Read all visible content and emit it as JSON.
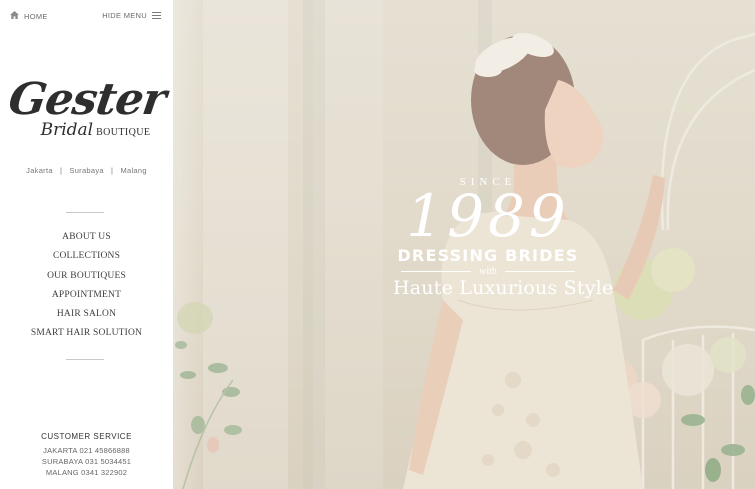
{
  "header": {
    "home_label": "HOME",
    "hide_menu_label": "HIDE MENU",
    "home_icon": "home-icon",
    "menu_icon": "hamburger-icon"
  },
  "brand": {
    "name": "Gester",
    "line2_italic": "Bridal",
    "line2_caps": "BOUTIQUE",
    "cities": "Jakarta   |   Surabaya   |   Malang"
  },
  "nav": {
    "items": [
      {
        "label": "ABOUT US"
      },
      {
        "label": "COLLECTIONS"
      },
      {
        "label": "OUR BOUTIQUES"
      },
      {
        "label": "APPOINTMENT"
      },
      {
        "label": "HAIR SALON"
      },
      {
        "label": "SMART HAIR SOLUTION"
      }
    ]
  },
  "customer_service": {
    "title": "CUSTOMER SERVICE",
    "lines": [
      "JAKARTA 021 45866888",
      "SURABAYA 031 5034451",
      "MALANG 0341 322902"
    ]
  },
  "hero": {
    "since": "SINCE",
    "year": "1989",
    "headline": "DRESSING BRIDES",
    "with": "with",
    "subline": "Haute Luxurious Style"
  },
  "colors": {
    "sidebar_bg": "#ffffff",
    "hero_tint": "#ddd7c9",
    "text_dark": "#2e2e2e",
    "overlay_text": "#ffffff"
  }
}
